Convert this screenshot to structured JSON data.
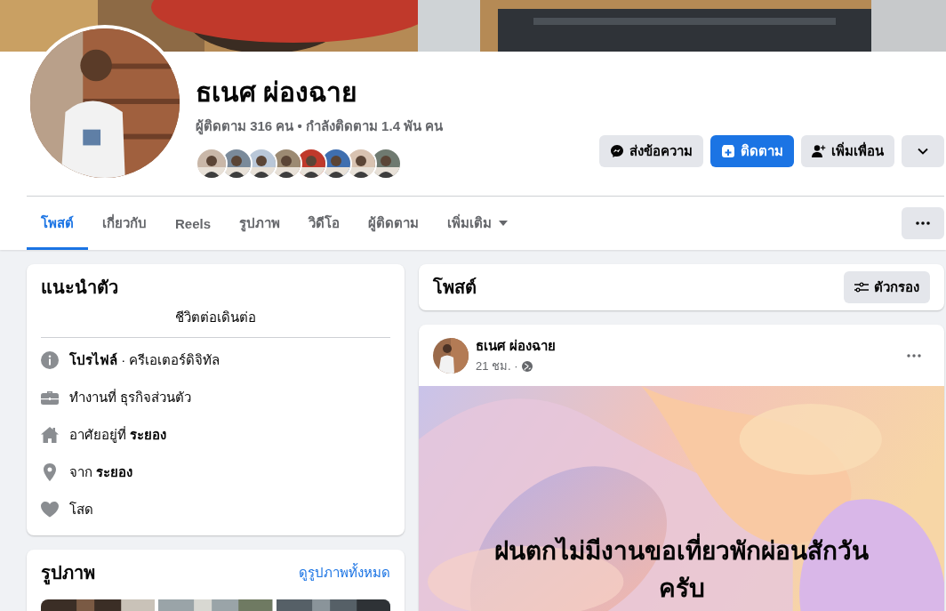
{
  "profile": {
    "name": "ธเนศ ผ่องฉาย",
    "stats": "ผู้ติดตาม 316 คน • กำลังติดตาม 1.4 พัน คน"
  },
  "actions": [
    {
      "kind": "message",
      "label": "ส่งข้อความ",
      "primary": false
    },
    {
      "kind": "follow",
      "label": "ติดตาม",
      "primary": true
    },
    {
      "kind": "add_friend",
      "label": "เพิ่มเพื่อน",
      "primary": false
    },
    {
      "kind": "expand",
      "primary": false
    }
  ],
  "tabs": [
    {
      "label": "โพสต์",
      "selected": true
    },
    {
      "label": "เกี่ยวกับ",
      "selected": false
    },
    {
      "label": "Reels",
      "selected": false
    },
    {
      "label": "รูปภาพ",
      "selected": false
    },
    {
      "label": "วิดีโอ",
      "selected": false
    },
    {
      "label": "ผู้ติดตาม",
      "selected": false
    },
    {
      "label": "เพิ่มเติม",
      "selected": false,
      "dropdown": true
    }
  ],
  "intro": {
    "title": "แนะนำตัว",
    "bio": "ชีวิตต่อเดินต่อ",
    "items": [
      {
        "kind": "info",
        "text": "**โปรไฟล์** · ครีเอเตอร์ดิจิทัล"
      },
      {
        "kind": "work",
        "text": "ทำงานที่ ธุรกิจส่วนตัว"
      },
      {
        "kind": "home",
        "text": "อาศัยอยู่ที่ **ระยอง**"
      },
      {
        "kind": "place",
        "text": "จาก **ระยอง**"
      },
      {
        "kind": "heart",
        "text": "โสด"
      }
    ]
  },
  "photos": {
    "title": "รูปภาพ",
    "link": "ดูรูปภาพทั้งหมด"
  },
  "posts_header": {
    "title": "โพสต์",
    "filter": "ตัวกรอง"
  },
  "post": {
    "author": "ธเนศ ผ่องฉาย",
    "time": "21 ชม. ·",
    "text": "ฝนตกไม่มีงานขอเที่ยวพักผ่อนสักวัน\nครับ"
  }
}
